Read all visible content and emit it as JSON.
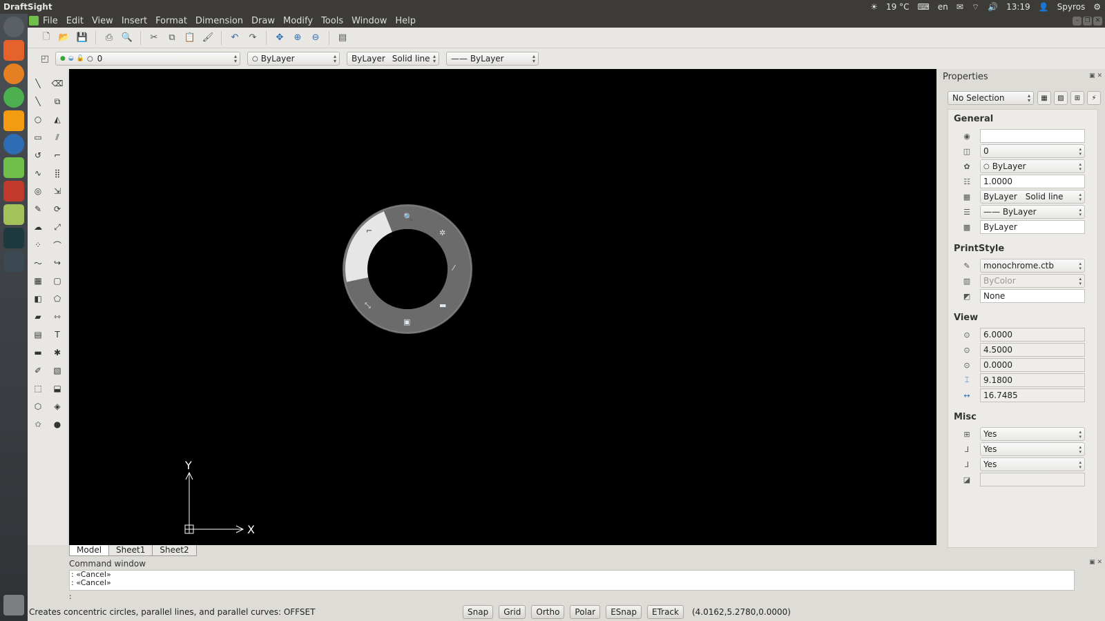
{
  "sysbar": {
    "title": "DraftSight",
    "weather": "19 °C",
    "keyboard": "en",
    "time": "13:19",
    "user": "Spyros"
  },
  "menu": [
    "File",
    "Edit",
    "View",
    "Insert",
    "Format",
    "Dimension",
    "Draw",
    "Modify",
    "Tools",
    "Window",
    "Help"
  ],
  "toolbar2": {
    "layer": "0",
    "color": "ByLayer",
    "linestyle_a": "ByLayer",
    "linestyle_b": "Solid line",
    "lineweight": "—— ByLayer"
  },
  "tabs": [
    "Model",
    "Sheet1",
    "Sheet2"
  ],
  "properties": {
    "title": "Properties",
    "selection": "No Selection",
    "general": {
      "title": "General",
      "color_field": "",
      "layer": "0",
      "color": "ByLayer",
      "scale": "1.0000",
      "linestyle_a": "ByLayer",
      "linestyle_b": "Solid line",
      "lineweight": "—— ByLayer",
      "transparency": "ByLayer"
    },
    "printstyle": {
      "title": "PrintStyle",
      "table": "monochrome.ctb",
      "style": "ByColor",
      "plot": "None"
    },
    "view": {
      "title": "View",
      "center_x": "6.0000",
      "center_y": "4.5000",
      "center_z": "0.0000",
      "height": "9.1800",
      "width": "16.7485"
    },
    "misc": {
      "title": "Misc",
      "ucs_icon_on": "Yes",
      "ucs_icon_origin": "Yes",
      "ucs_per_viewport": "Yes",
      "ucs_name": ""
    }
  },
  "command": {
    "title": "Command window",
    "line1": ": «Cancel»",
    "line2": ": «Cancel»",
    "prompt": ":"
  },
  "status": {
    "hint": "Creates concentric circles, parallel lines, and parallel curves:  OFFSET",
    "buttons": [
      "Snap",
      "Grid",
      "Ortho",
      "Polar",
      "ESnap",
      "ETrack"
    ],
    "coords": "(4.0162,5.2780,0.0000)"
  },
  "canvas": {
    "axis_x": "X",
    "axis_y": "Y"
  },
  "colors": {
    "canvas_bg": "#000000",
    "ubuntu_bar": "#3c3b37",
    "radial_ring": "#6b6b6b",
    "radial_highlight": "#e6e6e6"
  }
}
